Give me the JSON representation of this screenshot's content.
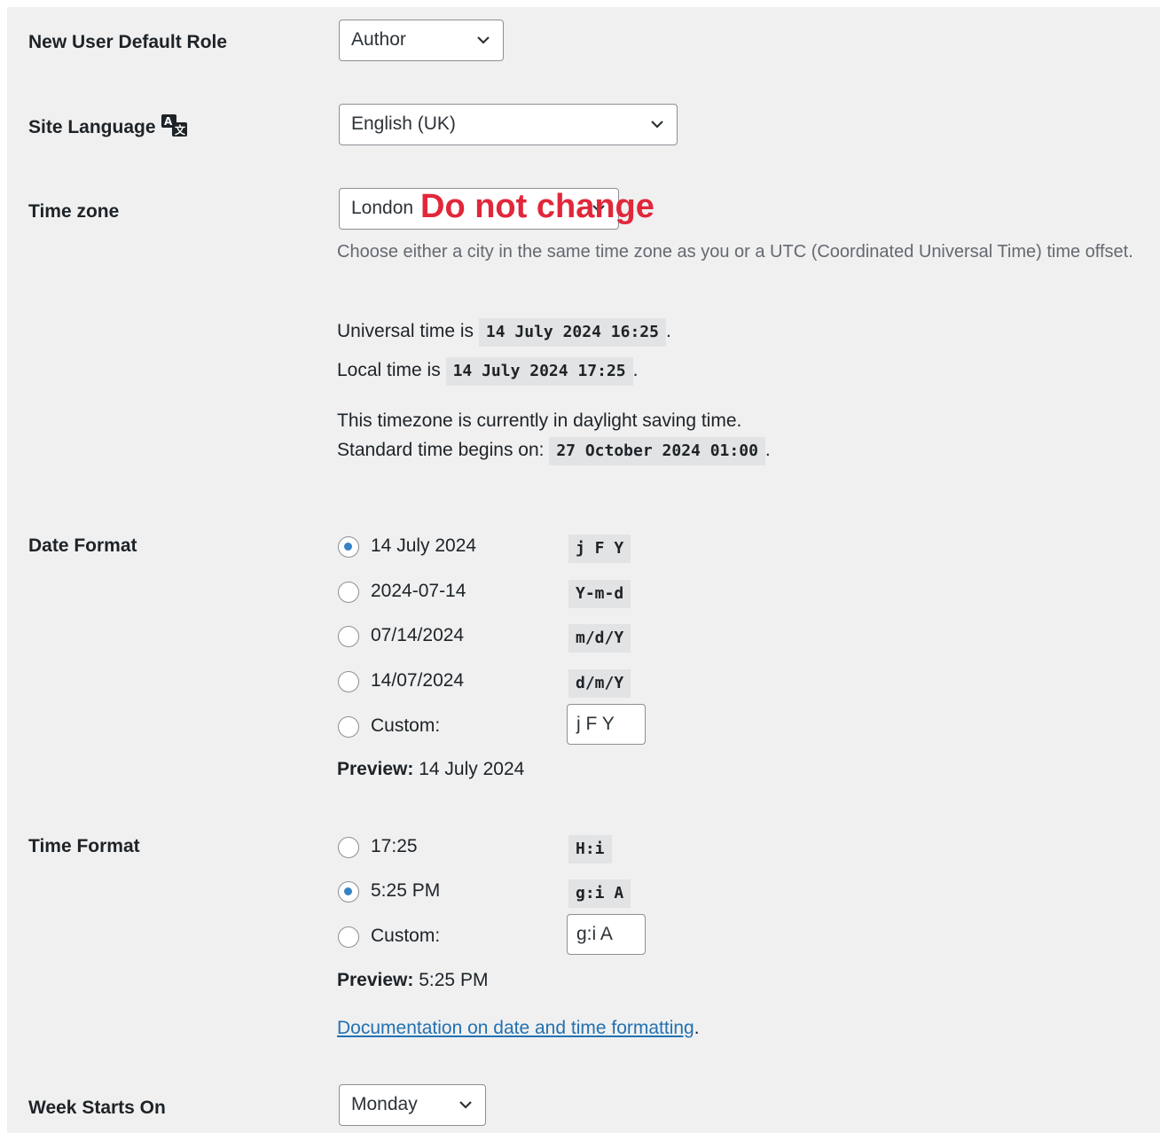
{
  "rows": {
    "new_user_role": {
      "label": "New User Default Role",
      "value": "Author"
    },
    "site_language": {
      "label": "Site Language",
      "value": "English (UK)"
    },
    "time_zone": {
      "label": "Time zone",
      "value": "London",
      "annotation": "Do not change",
      "description": "Choose either a city in the same time zone as you or a UTC (Coordinated Universal Time) time offset.",
      "universal_prefix": "Universal time is",
      "universal_value": "14 July 2024 16:25",
      "local_prefix": "Local time is",
      "local_value": "14 July 2024 17:25",
      "dst_line": "This timezone is currently in daylight saving time.",
      "standard_prefix": "Standard time begins on:",
      "standard_value": "27 October 2024 01:00",
      "period": "."
    },
    "date_format": {
      "label": "Date Format",
      "options": [
        {
          "label": "14 July 2024",
          "code": "j F Y",
          "checked": true
        },
        {
          "label": "2024-07-14",
          "code": "Y-m-d",
          "checked": false
        },
        {
          "label": "07/14/2024",
          "code": "m/d/Y",
          "checked": false
        },
        {
          "label": "14/07/2024",
          "code": "d/m/Y",
          "checked": false
        }
      ],
      "custom_label": "Custom:",
      "custom_value": "j F Y",
      "preview_label": "Preview:",
      "preview_value": "14 July 2024"
    },
    "time_format": {
      "label": "Time Format",
      "options": [
        {
          "label": "17:25",
          "code": "H:i",
          "checked": false
        },
        {
          "label": "5:25 PM",
          "code": "g:i A",
          "checked": true
        }
      ],
      "custom_label": "Custom:",
      "custom_value": "g:i A",
      "preview_label": "Preview:",
      "preview_value": "5:25 PM",
      "doc_link": "Documentation on date and time formatting"
    },
    "week_starts": {
      "label": "Week Starts On",
      "value": "Monday"
    }
  },
  "icons": {
    "language": "translate-icon",
    "dropdown": "chevron-down-icon"
  },
  "colors": {
    "accent": "#2271b1",
    "radio_checked": "#3582c4",
    "annotation": "#e1273a"
  }
}
